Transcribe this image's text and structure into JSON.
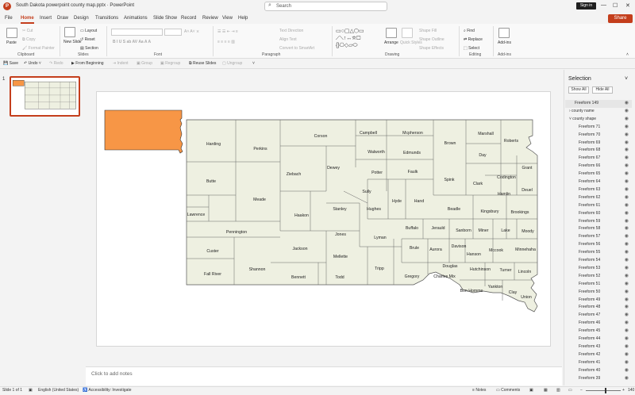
{
  "window": {
    "title": "South Dakota powerpoint county map.pptx  ·  PowerPoint",
    "app_icon": "P",
    "search_placeholder": "Search",
    "sign_in": "Sign in"
  },
  "menu": {
    "tabs": [
      "File",
      "Home",
      "Insert",
      "Draw",
      "Design",
      "Transitions",
      "Animations",
      "Slide Show",
      "Record",
      "Review",
      "View",
      "Help"
    ],
    "active": "Home",
    "share": "Share"
  },
  "ribbon": {
    "clipboard": {
      "label": "Clipboard",
      "paste": "Paste",
      "cut": "Cut",
      "copy": "Copy",
      "format_painter": "Format Painter"
    },
    "slides": {
      "label": "Slides",
      "new_slide": "New Slide",
      "layout": "Layout",
      "reset": "Reset",
      "section": "Section"
    },
    "font": {
      "label": "Font"
    },
    "paragraph": {
      "label": "Paragraph",
      "text_direction": "Text Direction",
      "align_text": "Align Text",
      "smartart": "Convert to SmartArt"
    },
    "drawing": {
      "label": "Drawing",
      "arrange": "Arrange",
      "quick_styles": "Quick Styles",
      "shape_fill": "Shape Fill",
      "shape_outline": "Shape Outline",
      "shape_effects": "Shape Effects"
    },
    "editing": {
      "label": "Editing",
      "find": "Find",
      "replace": "Replace",
      "select": "Select"
    },
    "addins": {
      "label": "Add-ins",
      "addins": "Add-ins"
    }
  },
  "qat": {
    "save": "Save",
    "undo": "Undo",
    "redo": "Redo",
    "from_beginning": "From Beginning",
    "indent": "Indent",
    "group": "Group",
    "regroup": "Regroup",
    "reuse": "Reuse Slides",
    "ungroup": "Ungroup"
  },
  "thumbnails": {
    "slide_number": "1"
  },
  "notes": {
    "placeholder": "Click to add notes"
  },
  "selection_pane": {
    "title": "Selection",
    "show_all": "Show All",
    "hide_all": "Hide All",
    "items": [
      "Freeform 149",
      "county name",
      "county shape",
      "Freeform 71",
      "Freeform 70",
      "Freeform 69",
      "Freeform 68",
      "Freeform 67",
      "Freeform 66",
      "Freeform 65",
      "Freeform 64",
      "Freeform 63",
      "Freeform 62",
      "Freeform 61",
      "Freeform 60",
      "Freeform 59",
      "Freeform 58",
      "Freeform 57",
      "Freeform 56",
      "Freeform 55",
      "Freeform 54",
      "Freeform 53",
      "Freeform 52",
      "Freeform 51",
      "Freeform 50",
      "Freeform 49",
      "Freeform 48",
      "Freeform 47",
      "Freeform 46",
      "Freeform 45",
      "Freeform 44",
      "Freeform 43",
      "Freeform 42",
      "Freeform 41",
      "Freeform 40",
      "Freeform 39"
    ]
  },
  "status": {
    "slide": "Slide 1 of 1",
    "language": "English (United States)",
    "accessibility": "Accessibility: Investigate",
    "notes": "Notes",
    "comments": "Comments",
    "zoom": "140"
  },
  "map": {
    "fill_color": "#eef0e1",
    "highlight_color": "#f79646",
    "counties": [
      "Harding",
      "Perkins",
      "Corson",
      "Campbell",
      "Mcpherson",
      "Brown",
      "Marshall",
      "Roberts",
      "Walworth",
      "Edmunds",
      "Day",
      "Grant",
      "Butte",
      "Ziebach",
      "Dewey",
      "Potter",
      "Faulk",
      "Spink",
      "Clark",
      "Codington",
      "Deuel",
      "Hamlin",
      "Sully",
      "Hyde",
      "Hand",
      "Lawrence",
      "Meade",
      "Haakon",
      "Stanley",
      "Hughes",
      "Beadle",
      "Kingsbury",
      "Brookings",
      "Pennington",
      "Jones",
      "Lyman",
      "Buffalo",
      "Jerauld",
      "Sanborn",
      "Miner",
      "Lake",
      "Moody",
      "Custer",
      "Jackson",
      "Brule",
      "Aurora",
      "Davison",
      "Hanson",
      "Mccook",
      "Minnehaha",
      "Mellette",
      "Fall River",
      "Shannon",
      "Bennett",
      "Todd",
      "Tripp",
      "Gregory",
      "Douglas",
      "Charles Mix",
      "Hutchinson",
      "Turner",
      "Lincoln",
      "Bon Homme",
      "Yankton",
      "Clay",
      "Union"
    ]
  }
}
